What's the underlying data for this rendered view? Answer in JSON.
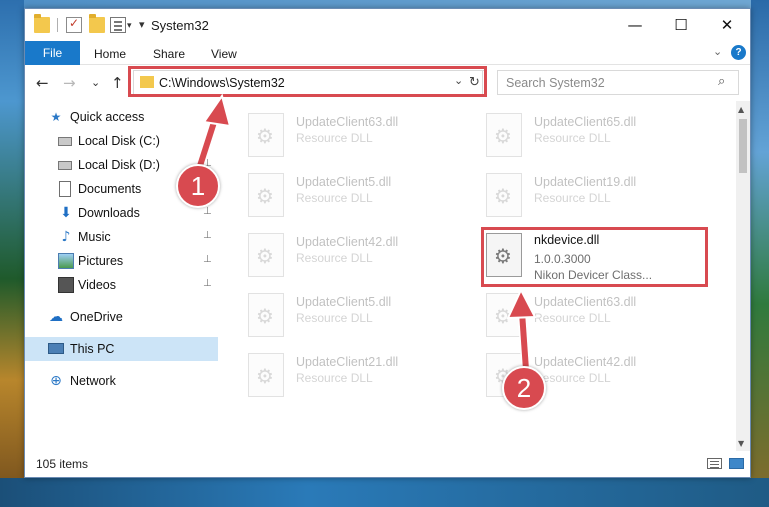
{
  "window": {
    "title": "System32",
    "minimize": "—",
    "maximize": "☐",
    "close": "✕"
  },
  "ribbon": {
    "file": "File",
    "tabs": [
      "Home",
      "Share",
      "View"
    ],
    "expand": "⌄",
    "help": "?"
  },
  "nav": {
    "back": "←",
    "forward": "→",
    "recent": "⌄",
    "up": "↑",
    "address": "C:\\Windows\\System32",
    "address_dropdown": "⌄",
    "refresh": "↻",
    "search_placeholder": "Search System32",
    "search_icon": "search-icon"
  },
  "sidebar": {
    "items": [
      {
        "label": "Quick access",
        "icon": "star-icon",
        "pinned": false
      },
      {
        "label": "Local Disk (C:)",
        "icon": "drive-icon",
        "pinned": false
      },
      {
        "label": "Local Disk (D:)",
        "icon": "drive-icon",
        "pinned": true
      },
      {
        "label": "Documents",
        "icon": "documents-icon",
        "pinned": true
      },
      {
        "label": "Downloads",
        "icon": "downloads-icon",
        "pinned": true
      },
      {
        "label": "Music",
        "icon": "music-icon",
        "pinned": true
      },
      {
        "label": "Pictures",
        "icon": "pictures-icon",
        "pinned": true
      },
      {
        "label": "Videos",
        "icon": "videos-icon",
        "pinned": true
      },
      {
        "label": "OneDrive",
        "icon": "onedrive-icon",
        "pinned": false
      },
      {
        "label": "This PC",
        "icon": "this-pc-icon",
        "pinned": false,
        "selected": true
      },
      {
        "label": "Network",
        "icon": "network-icon",
        "pinned": false
      }
    ],
    "pin_glyph": "📌"
  },
  "files": [
    {
      "name": "UpdateClient63.dll",
      "type": "Resource DLL"
    },
    {
      "name": "UpdateClient65.dll",
      "type": "Resource DLL"
    },
    {
      "name": "UpdateClient5.dll",
      "type": "Resource DLL"
    },
    {
      "name": "UpdateClient19.dll",
      "type": "Resource DLL"
    },
    {
      "name": "UpdateClient42.dll",
      "type": "Resource DLL"
    },
    {
      "name": "nkdevice.dll",
      "version": "1.0.0.3000",
      "description": "Nikon Devicer Class..."
    },
    {
      "name": "UpdateClient5.dll",
      "type": "Resource DLL"
    },
    {
      "name": "UpdateClient63.dll",
      "type": "Resource DLL"
    },
    {
      "name": "UpdateClient21.dll",
      "type": "Resource DLL"
    },
    {
      "name": "UpdateClient42.dll",
      "type": "Resource DLL"
    }
  ],
  "status": {
    "item_count": "105 items"
  },
  "annotations": {
    "badge1": "1",
    "badge2": "2",
    "color": "#d84a50"
  }
}
